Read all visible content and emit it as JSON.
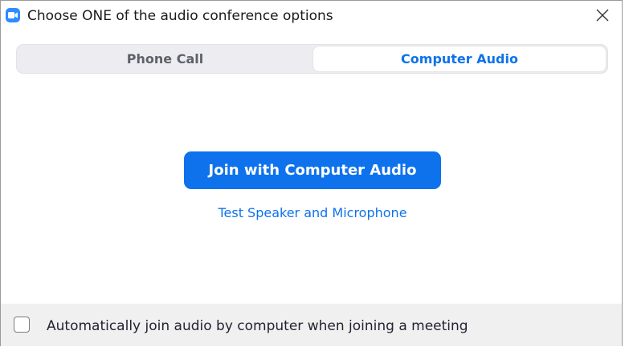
{
  "window": {
    "title": "Choose ONE of the audio conference options"
  },
  "tabs": [
    {
      "label": "Phone Call",
      "selected": false
    },
    {
      "label": "Computer Audio",
      "selected": true
    }
  ],
  "main": {
    "join_button_label": "Join with Computer Audio",
    "test_link_label": "Test Speaker and Microphone"
  },
  "footer": {
    "auto_join_label": "Automatically join audio by computer when joining a meeting",
    "auto_join_checked": false
  },
  "icons": {
    "app": "zoom-camera-icon",
    "close": "close-icon"
  },
  "colors": {
    "accent": "#0e72ed",
    "app_icon": "#2d8cff",
    "tab_track": "#ededf1",
    "footer_bg": "#f0f0f0"
  }
}
